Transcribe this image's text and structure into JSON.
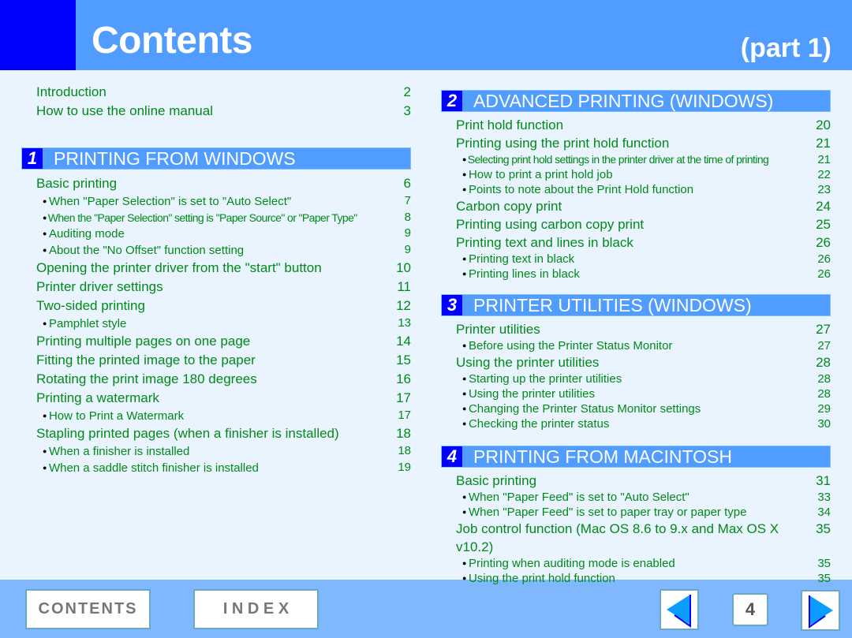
{
  "header": {
    "title": "Contents",
    "part": "(part 1)"
  },
  "intro": [
    {
      "label": "Introduction",
      "page": "2"
    },
    {
      "label": "How to use the online manual",
      "page": "3"
    }
  ],
  "sections": [
    {
      "num": "1",
      "title": "PRINTING FROM WINDOWS",
      "items": [
        {
          "label": "Basic printing",
          "page": "6",
          "level": "main"
        },
        {
          "label": "When \"Paper Selection\" is set to \"Auto Select\"",
          "page": "7",
          "level": "sub"
        },
        {
          "label": "When the \"Paper Selection\" setting is \"Paper Source\" or \"Paper Type\"",
          "page": "8",
          "level": "sub",
          "cond": true
        },
        {
          "label": "Auditing mode",
          "page": "9",
          "level": "sub"
        },
        {
          "label": "About the \"No Offset\" function setting",
          "page": "9",
          "level": "sub"
        },
        {
          "label": "Opening the printer driver from the \"start\" button",
          "page": "10",
          "level": "main"
        },
        {
          "label": "Printer driver settings",
          "page": "11",
          "level": "main"
        },
        {
          "label": "Two-sided printing",
          "page": "12",
          "level": "main"
        },
        {
          "label": "Pamphlet style",
          "page": "13",
          "level": "sub"
        },
        {
          "label": "Printing multiple pages on one page",
          "page": "14",
          "level": "main"
        },
        {
          "label": "Fitting the printed image to the paper",
          "page": "15",
          "level": "main"
        },
        {
          "label": "Rotating the print image 180 degrees",
          "page": "16",
          "level": "main"
        },
        {
          "label": "Printing a watermark",
          "page": "17",
          "level": "main"
        },
        {
          "label": "How to Print a Watermark",
          "page": "17",
          "level": "sub"
        },
        {
          "label": "Stapling printed pages (when a finisher is installed)",
          "page": "18",
          "level": "main"
        },
        {
          "label": "When a finisher is installed",
          "page": "18",
          "level": "sub"
        },
        {
          "label": "When a saddle stitch finisher is installed",
          "page": "19",
          "level": "sub"
        }
      ]
    },
    {
      "num": "2",
      "title": "ADVANCED PRINTING (WINDOWS)",
      "items": [
        {
          "label": "Print hold function",
          "page": "20",
          "level": "main"
        },
        {
          "label": "Printing using the print hold function",
          "page": "21",
          "level": "main"
        },
        {
          "label": "Selecting print hold settings in the printer driver at the time of printing",
          "page": "21",
          "level": "sub",
          "cond": true
        },
        {
          "label": "How to print a print hold job",
          "page": "22",
          "level": "sub"
        },
        {
          "label": "Points to note about the Print Hold function",
          "page": "23",
          "level": "sub"
        },
        {
          "label": "Carbon copy print",
          "page": "24",
          "level": "main"
        },
        {
          "label": "Printing using carbon copy print",
          "page": "25",
          "level": "main"
        },
        {
          "label": "Printing text and lines in black",
          "page": "26",
          "level": "main"
        },
        {
          "label": "Printing text in black",
          "page": "26",
          "level": "sub"
        },
        {
          "label": "Printing lines in black",
          "page": "26",
          "level": "sub"
        }
      ]
    },
    {
      "num": "3",
      "title": "PRINTER UTILITIES (WINDOWS)",
      "items": [
        {
          "label": "Printer utilities",
          "page": "27",
          "level": "main"
        },
        {
          "label": "Before using the Printer Status Monitor",
          "page": "27",
          "level": "sub"
        },
        {
          "label": "Using the printer utilities",
          "page": "28",
          "level": "main"
        },
        {
          "label": "Starting up the printer utilities",
          "page": "28",
          "level": "sub"
        },
        {
          "label": "Using the printer utilities",
          "page": "28",
          "level": "sub"
        },
        {
          "label": "Changing the Printer Status Monitor settings",
          "page": "29",
          "level": "sub"
        },
        {
          "label": "Checking the printer status",
          "page": "30",
          "level": "sub"
        }
      ]
    },
    {
      "num": "4",
      "title": "PRINTING FROM MACINTOSH",
      "items": [
        {
          "label": "Basic printing",
          "page": "31",
          "level": "main"
        },
        {
          "label": "When \"Paper Feed\" is set to \"Auto Select\"",
          "page": "33",
          "level": "sub"
        },
        {
          "label": "When \"Paper Feed\" is set to paper tray or paper type",
          "page": "34",
          "level": "sub"
        },
        {
          "label": "Job control function (Mac OS 8.6 to 9.x and Max OS X v10.2)",
          "page": "35",
          "level": "main"
        },
        {
          "label": "Printing when auditing mode is enabled",
          "page": "35",
          "level": "sub"
        },
        {
          "label": "Using the print hold function",
          "page": "35",
          "level": "sub"
        }
      ]
    }
  ],
  "footer": {
    "contents": "CONTENTS",
    "index": "I N D E X",
    "page": "4"
  },
  "colors": {
    "header": "#509cff",
    "accent": "#0000ff",
    "text": "#008a18",
    "background": "#eaf4fe"
  }
}
